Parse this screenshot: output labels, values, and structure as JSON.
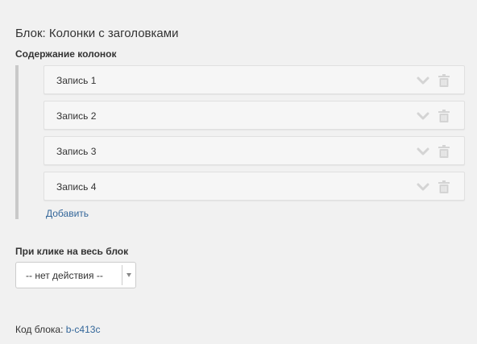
{
  "block_title": "Блок: Колонки с заголовками",
  "content_section": {
    "label": "Содержание колонок",
    "items": [
      {
        "label": "Запись 1",
        "icons": [
          "chevron-down-icon",
          "trash-icon"
        ]
      },
      {
        "label": "Запись 2",
        "icons": [
          "chevron-down-icon",
          "trash-icon"
        ]
      },
      {
        "label": "Запись 3",
        "icons": [
          "chevron-down-icon",
          "trash-icon"
        ]
      },
      {
        "label": "Запись 4",
        "icons": [
          "chevron-down-icon",
          "trash-icon"
        ]
      }
    ],
    "add_label": "Добавить"
  },
  "click_action": {
    "label": "При клике на весь блок",
    "selected": "-- нет действия --"
  },
  "block_code": {
    "label": "Код блока:",
    "value": "b-c413c"
  },
  "colors": {
    "background": "#f1f1f1",
    "link": "#336699",
    "icon": "#d4d4d4"
  }
}
